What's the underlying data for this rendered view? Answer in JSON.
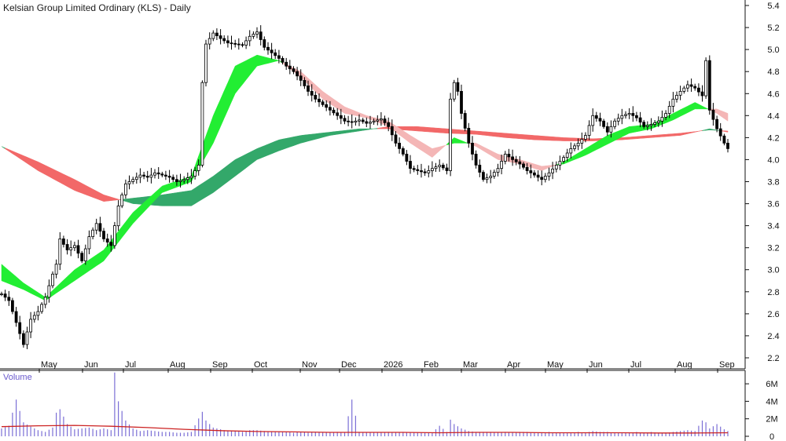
{
  "chart_data": {
    "type": "candlestick",
    "title": "Kelsian Group Limited Ordinary (KLS) - Daily",
    "price_axis": {
      "ticks": [
        "5.4",
        "5.2",
        "5.0",
        "4.8",
        "4.6",
        "4.4",
        "4.2",
        "4.0",
        "3.8",
        "3.6",
        "3.4",
        "3.2",
        "3.0",
        "2.8",
        "2.6",
        "2.4",
        "2.2"
      ],
      "ylim": [
        2.1,
        5.45
      ],
      "side": "right",
      "grid": false
    },
    "x_axis": {
      "labels": [
        "May",
        "Jun",
        "Jul",
        "Aug",
        "Sep",
        "Oct",
        "Nov",
        "Dec",
        "2026",
        "Feb",
        "Mar",
        "Apr",
        "May",
        "Jun",
        "Jul",
        "Aug",
        "Sep"
      ]
    },
    "price_close": [
      [
        0,
        2.78
      ],
      [
        2,
        2.72
      ],
      [
        4,
        2.52
      ],
      [
        6,
        2.32
      ],
      [
        8,
        2.55
      ],
      [
        10,
        2.62
      ],
      [
        12,
        2.75
      ],
      [
        14,
        2.96
      ],
      [
        15,
        3.05
      ],
      [
        16,
        3.28
      ],
      [
        18,
        3.18
      ],
      [
        20,
        3.22
      ],
      [
        22,
        3.08
      ],
      [
        24,
        3.3
      ],
      [
        26,
        3.42
      ],
      [
        28,
        3.28
      ],
      [
        30,
        3.22
      ],
      [
        32,
        3.58
      ],
      [
        34,
        3.78
      ],
      [
        36,
        3.82
      ],
      [
        38,
        3.86
      ],
      [
        40,
        3.84
      ],
      [
        42,
        3.88
      ],
      [
        44,
        3.86
      ],
      [
        46,
        3.84
      ],
      [
        48,
        3.8
      ],
      [
        50,
        3.82
      ],
      [
        52,
        3.85
      ],
      [
        54,
        3.95
      ],
      [
        55,
        4.7
      ],
      [
        56,
        5.05
      ],
      [
        58,
        5.15
      ],
      [
        60,
        5.1
      ],
      [
        62,
        5.06
      ],
      [
        64,
        5.05
      ],
      [
        66,
        5.04
      ],
      [
        68,
        5.12
      ],
      [
        70,
        5.16
      ],
      [
        72,
        5.02
      ],
      [
        74,
        4.97
      ],
      [
        76,
        4.92
      ],
      [
        78,
        4.85
      ],
      [
        80,
        4.8
      ],
      [
        82,
        4.72
      ],
      [
        84,
        4.62
      ],
      [
        86,
        4.55
      ],
      [
        88,
        4.5
      ],
      [
        90,
        4.45
      ],
      [
        92,
        4.4
      ],
      [
        94,
        4.35
      ],
      [
        96,
        4.34
      ],
      [
        98,
        4.36
      ],
      [
        100,
        4.33
      ],
      [
        102,
        4.35
      ],
      [
        104,
        4.37
      ],
      [
        106,
        4.3
      ],
      [
        108,
        4.15
      ],
      [
        110,
        4.05
      ],
      [
        112,
        3.92
      ],
      [
        114,
        3.9
      ],
      [
        116,
        3.88
      ],
      [
        118,
        3.92
      ],
      [
        120,
        3.95
      ],
      [
        122,
        3.9
      ],
      [
        123,
        4.55
      ],
      [
        124,
        4.7
      ],
      [
        125,
        4.62
      ],
      [
        126,
        4.42
      ],
      [
        128,
        4.15
      ],
      [
        130,
        3.95
      ],
      [
        132,
        3.82
      ],
      [
        134,
        3.85
      ],
      [
        136,
        3.92
      ],
      [
        138,
        4.05
      ],
      [
        140,
        4.0
      ],
      [
        142,
        3.96
      ],
      [
        144,
        3.9
      ],
      [
        146,
        3.86
      ],
      [
        148,
        3.82
      ],
      [
        150,
        3.88
      ],
      [
        152,
        3.95
      ],
      [
        154,
        4.02
      ],
      [
        156,
        4.1
      ],
      [
        158,
        4.15
      ],
      [
        160,
        4.22
      ],
      [
        162,
        4.4
      ],
      [
        164,
        4.35
      ],
      [
        166,
        4.25
      ],
      [
        168,
        4.35
      ],
      [
        170,
        4.4
      ],
      [
        172,
        4.42
      ],
      [
        174,
        4.38
      ],
      [
        176,
        4.3
      ],
      [
        178,
        4.32
      ],
      [
        180,
        4.35
      ],
      [
        182,
        4.42
      ],
      [
        184,
        4.55
      ],
      [
        186,
        4.62
      ],
      [
        188,
        4.68
      ],
      [
        190,
        4.65
      ],
      [
        192,
        4.58
      ],
      [
        193,
        4.9
      ],
      [
        194,
        4.45
      ],
      [
        196,
        4.28
      ],
      [
        198,
        4.15
      ],
      [
        199,
        4.1
      ]
    ],
    "ema_short_fast": [
      [
        0,
        3.05
      ],
      [
        6,
        2.88
      ],
      [
        12,
        2.75
      ],
      [
        20,
        3.0
      ],
      [
        28,
        3.18
      ],
      [
        36,
        3.52
      ],
      [
        44,
        3.76
      ],
      [
        52,
        3.85
      ],
      [
        58,
        4.4
      ],
      [
        64,
        4.85
      ],
      [
        70,
        4.95
      ],
      [
        76,
        4.9
      ],
      [
        82,
        4.75
      ],
      [
        88,
        4.55
      ],
      [
        94,
        4.42
      ],
      [
        100,
        4.38
      ],
      [
        106,
        4.3
      ],
      [
        112,
        4.15
      ],
      [
        118,
        4.02
      ],
      [
        124,
        4.2
      ],
      [
        130,
        4.12
      ],
      [
        136,
        4.0
      ],
      [
        142,
        3.96
      ],
      [
        148,
        3.9
      ],
      [
        154,
        3.98
      ],
      [
        160,
        4.1
      ],
      [
        166,
        4.22
      ],
      [
        172,
        4.3
      ],
      [
        178,
        4.32
      ],
      [
        184,
        4.42
      ],
      [
        190,
        4.52
      ],
      [
        196,
        4.42
      ],
      [
        199,
        4.35
      ]
    ],
    "ema_short_slow": [
      [
        0,
        2.9
      ],
      [
        6,
        2.82
      ],
      [
        12,
        2.72
      ],
      [
        20,
        2.9
      ],
      [
        28,
        3.08
      ],
      [
        36,
        3.42
      ],
      [
        44,
        3.7
      ],
      [
        52,
        3.8
      ],
      [
        58,
        4.15
      ],
      [
        64,
        4.6
      ],
      [
        70,
        4.85
      ],
      [
        76,
        4.9
      ],
      [
        82,
        4.8
      ],
      [
        88,
        4.62
      ],
      [
        94,
        4.48
      ],
      [
        100,
        4.4
      ],
      [
        106,
        4.35
      ],
      [
        112,
        4.22
      ],
      [
        118,
        4.1
      ],
      [
        124,
        4.15
      ],
      [
        130,
        4.15
      ],
      [
        136,
        4.05
      ],
      [
        142,
        4.0
      ],
      [
        148,
        3.94
      ],
      [
        154,
        3.96
      ],
      [
        160,
        4.04
      ],
      [
        166,
        4.14
      ],
      [
        172,
        4.24
      ],
      [
        178,
        4.28
      ],
      [
        184,
        4.36
      ],
      [
        190,
        4.46
      ],
      [
        196,
        4.46
      ],
      [
        199,
        4.42
      ]
    ],
    "ema_long_fast": [
      [
        0,
        4.12
      ],
      [
        10,
        3.9
      ],
      [
        20,
        3.72
      ],
      [
        28,
        3.62
      ],
      [
        36,
        3.65
      ],
      [
        44,
        3.68
      ],
      [
        52,
        3.72
      ],
      [
        58,
        3.85
      ],
      [
        64,
        4.0
      ],
      [
        70,
        4.1
      ],
      [
        76,
        4.18
      ],
      [
        82,
        4.22
      ],
      [
        90,
        4.25
      ],
      [
        98,
        4.28
      ],
      [
        106,
        4.28
      ],
      [
        114,
        4.26
      ],
      [
        122,
        4.24
      ],
      [
        130,
        4.23
      ],
      [
        138,
        4.2
      ],
      [
        146,
        4.18
      ],
      [
        154,
        4.17
      ],
      [
        162,
        4.17
      ],
      [
        170,
        4.18
      ],
      [
        178,
        4.2
      ],
      [
        186,
        4.22
      ],
      [
        194,
        4.28
      ],
      [
        199,
        4.25
      ]
    ],
    "ema_long_slow": [
      [
        0,
        4.12
      ],
      [
        10,
        3.98
      ],
      [
        20,
        3.82
      ],
      [
        28,
        3.68
      ],
      [
        36,
        3.6
      ],
      [
        44,
        3.58
      ],
      [
        52,
        3.58
      ],
      [
        58,
        3.7
      ],
      [
        64,
        3.85
      ],
      [
        70,
        4.0
      ],
      [
        76,
        4.08
      ],
      [
        82,
        4.15
      ],
      [
        90,
        4.22
      ],
      [
        98,
        4.26
      ],
      [
        106,
        4.3
      ],
      [
        114,
        4.3
      ],
      [
        122,
        4.28
      ],
      [
        130,
        4.26
      ],
      [
        138,
        4.24
      ],
      [
        146,
        4.22
      ],
      [
        154,
        4.2
      ],
      [
        162,
        4.19
      ],
      [
        170,
        4.2
      ],
      [
        178,
        4.22
      ],
      [
        186,
        4.24
      ],
      [
        194,
        4.27
      ],
      [
        199,
        4.26
      ]
    ],
    "volume": {
      "label": "Volume",
      "ticks": [
        "6M",
        "4M",
        "2M",
        "0"
      ],
      "ylim": [
        0,
        7
      ],
      "unit": "M",
      "bars": [
        [
          0,
          0.9
        ],
        [
          2,
          1.2
        ],
        [
          4,
          4.2
        ],
        [
          6,
          1.6
        ],
        [
          8,
          1.1
        ],
        [
          10,
          0.7
        ],
        [
          12,
          0.5
        ],
        [
          14,
          1.0
        ],
        [
          15,
          2.7
        ],
        [
          16,
          3.1
        ],
        [
          18,
          1.4
        ],
        [
          20,
          0.8
        ],
        [
          22,
          0.9
        ],
        [
          24,
          1.0
        ],
        [
          26,
          0.7
        ],
        [
          28,
          0.9
        ],
        [
          30,
          0.7
        ],
        [
          31,
          7.3
        ],
        [
          32,
          4.0
        ],
        [
          34,
          1.8
        ],
        [
          36,
          0.9
        ],
        [
          38,
          0.6
        ],
        [
          40,
          0.7
        ],
        [
          42,
          0.6
        ],
        [
          44,
          0.5
        ],
        [
          46,
          0.5
        ],
        [
          48,
          0.4
        ],
        [
          50,
          0.4
        ],
        [
          52,
          0.5
        ],
        [
          55,
          2.8
        ],
        [
          56,
          1.8
        ],
        [
          58,
          1.0
        ],
        [
          60,
          0.8
        ],
        [
          62,
          0.6
        ],
        [
          64,
          0.6
        ],
        [
          66,
          0.5
        ],
        [
          68,
          0.7
        ],
        [
          70,
          0.7
        ],
        [
          72,
          0.6
        ],
        [
          74,
          0.5
        ],
        [
          76,
          0.5
        ],
        [
          78,
          0.5
        ],
        [
          80,
          0.4
        ],
        [
          82,
          0.5
        ],
        [
          84,
          0.4
        ],
        [
          86,
          0.5
        ],
        [
          88,
          0.4
        ],
        [
          90,
          0.4
        ],
        [
          92,
          0.5
        ],
        [
          94,
          0.4
        ],
        [
          96,
          4.2
        ],
        [
          98,
          0.5
        ],
        [
          100,
          0.4
        ],
        [
          102,
          0.4
        ],
        [
          104,
          0.4
        ],
        [
          106,
          0.5
        ],
        [
          108,
          0.4
        ],
        [
          110,
          0.5
        ],
        [
          112,
          0.4
        ],
        [
          114,
          0.4
        ],
        [
          116,
          0.4
        ],
        [
          118,
          0.4
        ],
        [
          120,
          1.2
        ],
        [
          122,
          0.5
        ],
        [
          123,
          1.9
        ],
        [
          124,
          1.4
        ],
        [
          126,
          0.9
        ],
        [
          128,
          0.6
        ],
        [
          130,
          0.5
        ],
        [
          132,
          0.5
        ],
        [
          134,
          0.5
        ],
        [
          136,
          0.4
        ],
        [
          138,
          0.5
        ],
        [
          140,
          0.4
        ],
        [
          142,
          0.5
        ],
        [
          144,
          0.5
        ],
        [
          146,
          0.4
        ],
        [
          148,
          0.4
        ],
        [
          150,
          0.5
        ],
        [
          152,
          0.4
        ],
        [
          154,
          0.4
        ],
        [
          156,
          0.4
        ],
        [
          158,
          0.5
        ],
        [
          160,
          0.4
        ],
        [
          162,
          0.6
        ],
        [
          164,
          0.5
        ],
        [
          166,
          0.5
        ],
        [
          168,
          0.4
        ],
        [
          170,
          0.4
        ],
        [
          172,
          0.4
        ],
        [
          174,
          0.5
        ],
        [
          176,
          0.4
        ],
        [
          178,
          0.5
        ],
        [
          180,
          0.4
        ],
        [
          182,
          0.4
        ],
        [
          184,
          0.5
        ],
        [
          186,
          0.6
        ],
        [
          188,
          0.7
        ],
        [
          190,
          0.6
        ],
        [
          192,
          1.8
        ],
        [
          193,
          1.6
        ],
        [
          194,
          0.9
        ],
        [
          196,
          1.4
        ],
        [
          198,
          0.8
        ],
        [
          199,
          0.6
        ]
      ],
      "ma": [
        [
          0,
          1.1
        ],
        [
          10,
          1.2
        ],
        [
          20,
          1.25
        ],
        [
          30,
          1.15
        ],
        [
          40,
          1.0
        ],
        [
          50,
          0.8
        ],
        [
          60,
          0.65
        ],
        [
          70,
          0.55
        ],
        [
          80,
          0.5
        ],
        [
          90,
          0.45
        ],
        [
          100,
          0.45
        ],
        [
          110,
          0.45
        ],
        [
          120,
          0.4
        ],
        [
          130,
          0.45
        ],
        [
          140,
          0.45
        ],
        [
          150,
          0.4
        ],
        [
          160,
          0.4
        ],
        [
          170,
          0.4
        ],
        [
          180,
          0.38
        ],
        [
          190,
          0.38
        ],
        [
          199,
          0.4
        ]
      ]
    }
  },
  "colors": {
    "background": "#ffffff",
    "candle": "#000000",
    "short_ribbon_up": "#22ee33",
    "short_ribbon_down": "#f4b6b6",
    "long_ribbon_up": "#33a86a",
    "long_ribbon_down": "#f26868",
    "ribbon_transition": "#f07030",
    "volume_bar": "#7b6fd6",
    "volume_ma": "#cc2222",
    "axis": "#111111"
  }
}
